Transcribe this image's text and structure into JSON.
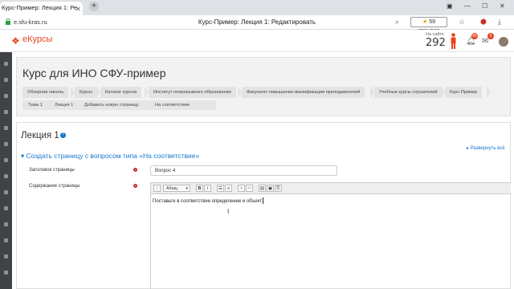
{
  "browser": {
    "tab_title": "Курс-Пример: Лекция 1: Ре",
    "url": "e.sfu-kras.ru",
    "page_title": "Курс-Пример: Лекция 1: Редактировать",
    "reviews_label": "59 отзывов"
  },
  "header": {
    "logo_text": "eКурсы",
    "online_label": "На сайте",
    "online_count": "292",
    "notif_count": "89",
    "msg_count": "5"
  },
  "course": {
    "title": "Курс для ИНО СФУ-пример",
    "breadcrumbs": [
      "Обзорная панель",
      "Курсы",
      "Каталог курсов",
      "Институт непрерывного образования",
      "Факультет повышения квалификации преподавателей",
      "Учебные курсы слушателей",
      "Курс-Пример"
    ],
    "subnav": [
      "Тема 1",
      "Лекция 1",
      "Добавить новую страницу",
      "На соответствие"
    ]
  },
  "main": {
    "heading": "Лекция 1",
    "expand_all": "Развернуть всё",
    "section_title": "Создать страницу с вопросом типа «На соответствие»",
    "page_title_label": "Заголовок страницы",
    "page_title_value": "Вопрос 4",
    "content_label": "Содержание страницы",
    "format_select": "Абзац",
    "editor_text": "Поставьте в соответствие определение и объект"
  }
}
